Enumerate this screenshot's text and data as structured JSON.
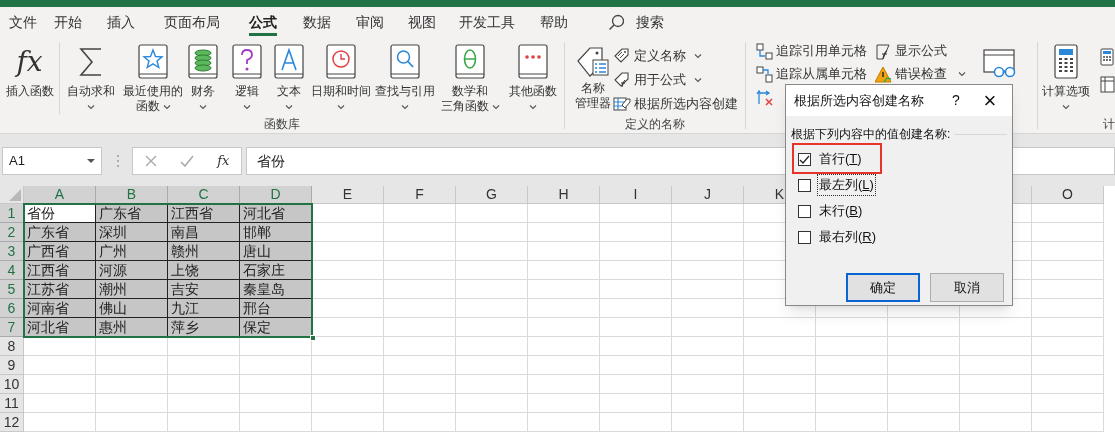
{
  "tabs": [
    {
      "label": "文件",
      "selected": false
    },
    {
      "label": "开始",
      "selected": false
    },
    {
      "label": "插入",
      "selected": false
    },
    {
      "label": "页面布局",
      "selected": false
    },
    {
      "label": "公式",
      "selected": true
    },
    {
      "label": "数据",
      "selected": false
    },
    {
      "label": "审阅",
      "selected": false
    },
    {
      "label": "视图",
      "selected": false
    },
    {
      "label": "开发工具",
      "selected": false
    },
    {
      "label": "帮助",
      "selected": false
    }
  ],
  "search": {
    "label": "搜索"
  },
  "ribbon": {
    "function_library": {
      "label": "函数库",
      "buttons": [
        {
          "lines": [
            "插入函数"
          ],
          "dropdown": false,
          "glyph": "fx"
        },
        {
          "lines": [
            "自动求和"
          ],
          "dropdown": true
        },
        {
          "lines": [
            "最近使用的",
            "函数"
          ],
          "dropdown": true
        },
        {
          "lines": [
            "财务"
          ],
          "dropdown": true
        },
        {
          "lines": [
            "逻辑"
          ],
          "dropdown": true
        },
        {
          "lines": [
            "文本"
          ],
          "dropdown": true
        },
        {
          "lines": [
            "日期和时间"
          ],
          "dropdown": true
        },
        {
          "lines": [
            "查找与引用"
          ],
          "dropdown": true
        },
        {
          "lines": [
            "数学和",
            "三角函数"
          ],
          "dropdown": true
        },
        {
          "lines": [
            "其他函数"
          ],
          "dropdown": true
        }
      ]
    },
    "defined_names": {
      "label": "定义的名称",
      "manager": {
        "lines": [
          "名称",
          "管理器"
        ]
      },
      "commands": [
        {
          "label": "定义名称",
          "dropdown": true
        },
        {
          "label": "用于公式",
          "dropdown": true
        },
        {
          "label": "根据所选内容创建",
          "dropdown": false
        }
      ]
    },
    "formula_auditing": {
      "commands": [
        {
          "label": "追踪引用单元格",
          "dropdown": false
        },
        {
          "label": "显示公式",
          "dropdown": false
        },
        {
          "label": "追踪从属单元格",
          "dropdown": false
        },
        {
          "label": "错误检查",
          "dropdown": true
        }
      ]
    },
    "calculation": {
      "label": "计",
      "options_button": {
        "label": "计算选项",
        "dropdown": true
      }
    }
  },
  "formula_bar": {
    "name_box": "A1",
    "fx_button": "fx",
    "formula": "省份"
  },
  "sheet": {
    "columns": [
      {
        "kind": "header",
        "label": "A",
        "selected": true
      },
      {
        "kind": "header",
        "label": "B",
        "selected": true
      },
      {
        "kind": "header",
        "label": "C",
        "selected": true
      },
      {
        "kind": "header",
        "label": "D",
        "selected": true
      },
      {
        "kind": "header",
        "label": "E",
        "selected": false
      },
      {
        "kind": "header",
        "label": "F",
        "selected": false
      },
      {
        "kind": "header",
        "label": "G",
        "selected": false
      },
      {
        "kind": "header",
        "label": "H",
        "selected": false
      },
      {
        "kind": "header",
        "label": "I",
        "selected": false
      },
      {
        "kind": "header",
        "label": "J",
        "selected": false
      },
      {
        "kind": "header",
        "label": "K",
        "selected": false
      },
      {
        "kind": "covered"
      },
      {
        "kind": "covered"
      },
      {
        "kind": "covered"
      },
      {
        "kind": "header",
        "label": "O",
        "selected": false
      }
    ],
    "rows": [
      {
        "number": "1",
        "selected": true,
        "cells": [
          {
            "value": "省份",
            "active": true
          },
          {
            "value": "广东省",
            "active": false
          },
          {
            "value": "江西省",
            "active": false
          },
          {
            "value": "河北省",
            "active": false
          }
        ]
      },
      {
        "number": "2",
        "selected": true,
        "cells": [
          {
            "value": "广东省",
            "active": false
          },
          {
            "value": "深圳",
            "active": false
          },
          {
            "value": "南昌",
            "active": false
          },
          {
            "value": "邯郸",
            "active": false
          }
        ]
      },
      {
        "number": "3",
        "selected": true,
        "cells": [
          {
            "value": "广西省",
            "active": false
          },
          {
            "value": "广州",
            "active": false
          },
          {
            "value": "赣州",
            "active": false
          },
          {
            "value": "唐山",
            "active": false
          }
        ]
      },
      {
        "number": "4",
        "selected": true,
        "cells": [
          {
            "value": "江西省",
            "active": false
          },
          {
            "value": "河源",
            "active": false
          },
          {
            "value": "上饶",
            "active": false
          },
          {
            "value": "石家庄",
            "active": false
          }
        ]
      },
      {
        "number": "5",
        "selected": true,
        "cells": [
          {
            "value": "江苏省",
            "active": false
          },
          {
            "value": "潮州",
            "active": false
          },
          {
            "value": "吉安",
            "active": false
          },
          {
            "value": "秦皇岛",
            "active": false
          }
        ]
      },
      {
        "number": "6",
        "selected": true,
        "cells": [
          {
            "value": "河南省",
            "active": false
          },
          {
            "value": "佛山",
            "active": false
          },
          {
            "value": "九江",
            "active": false
          },
          {
            "value": "邢台",
            "active": false
          }
        ]
      },
      {
        "number": "7",
        "selected": true,
        "cells": [
          {
            "value": "河北省",
            "active": false
          },
          {
            "value": "惠州",
            "active": false
          },
          {
            "value": "萍乡",
            "active": false
          },
          {
            "value": "保定",
            "active": false
          }
        ]
      },
      {
        "number": "8",
        "selected": false
      },
      {
        "number": "9",
        "selected": false
      },
      {
        "number": "10",
        "selected": false
      },
      {
        "number": "11",
        "selected": false
      },
      {
        "number": "12",
        "selected": false
      }
    ]
  },
  "dialog": {
    "title": "根据所选内容创建名称",
    "help": "?",
    "close": "×",
    "prompt": "根据下列内容中的值创建名称:",
    "options": [
      {
        "label": "首行(T)",
        "checked": true,
        "focused": false,
        "highlighted": true
      },
      {
        "label": "最左列(L)",
        "checked": false,
        "focused": true,
        "highlighted": false
      },
      {
        "label": "末行(B)",
        "checked": false,
        "focused": false,
        "highlighted": false
      },
      {
        "label": "最右列(R)",
        "checked": false,
        "focused": false,
        "highlighted": false
      }
    ],
    "buttons": [
      {
        "label": "确定",
        "default": true
      },
      {
        "label": "取消",
        "default": false
      }
    ]
  }
}
